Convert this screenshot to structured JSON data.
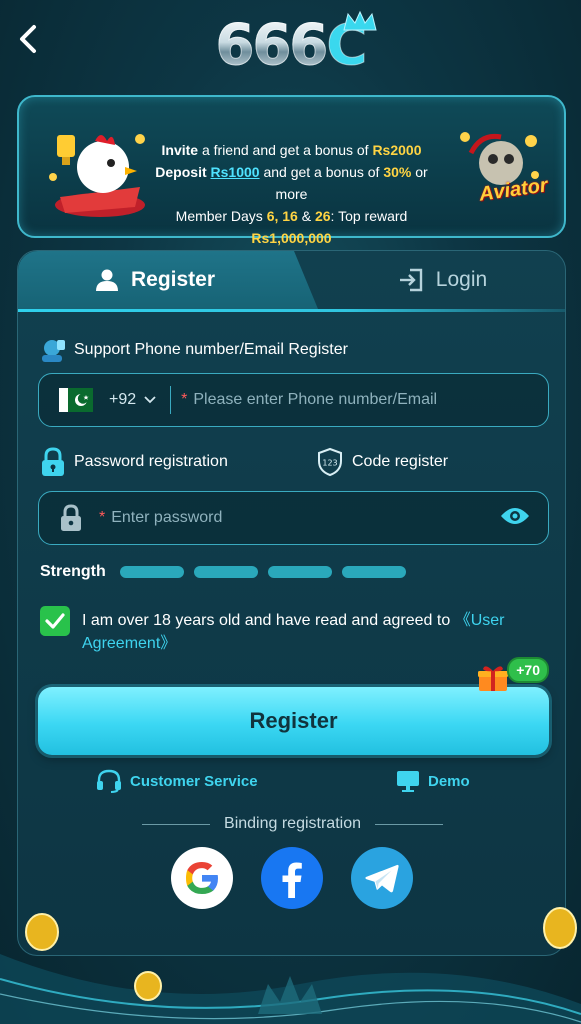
{
  "header": {
    "logo_text": "666",
    "logo_c": "C"
  },
  "promo": {
    "line1": {
      "a": "Invite",
      "b": " a friend and get a bonus of ",
      "c": "Rs2000"
    },
    "line2": {
      "a": "Deposit ",
      "b": "Rs1000",
      "c": " and get a bonus of ",
      "d": "30%",
      "e": " or more"
    },
    "line3": {
      "a": "Member Days ",
      "b": "6",
      "c": ", ",
      "d": "16",
      "e": " & ",
      "f": "26",
      "g": ": Top reward ",
      "h": "Rs1,000,000"
    },
    "aviator_label": "Aviator"
  },
  "tabs": {
    "register": "Register",
    "login": "Login"
  },
  "form": {
    "support_label": "Support Phone number/Email Register",
    "country_code": "+92",
    "phone_placeholder": "Please enter Phone number/Email",
    "required_mark": "*",
    "password_registration": "Password registration",
    "code_register": "Code register",
    "password_placeholder": "Enter password",
    "strength_label": "Strength",
    "agree_text": "I am over 18 years old and have read and agreed to ",
    "agree_link": "《User Agreement》",
    "register_button": "Register",
    "bonus_badge": "+70"
  },
  "links": {
    "customer_service": "Customer Service",
    "demo": "Demo"
  },
  "binding": {
    "label": "Binding registration"
  },
  "colors": {
    "accent": "#3ed3ee",
    "check_green": "#29c24b",
    "gold": "#ffd443"
  }
}
